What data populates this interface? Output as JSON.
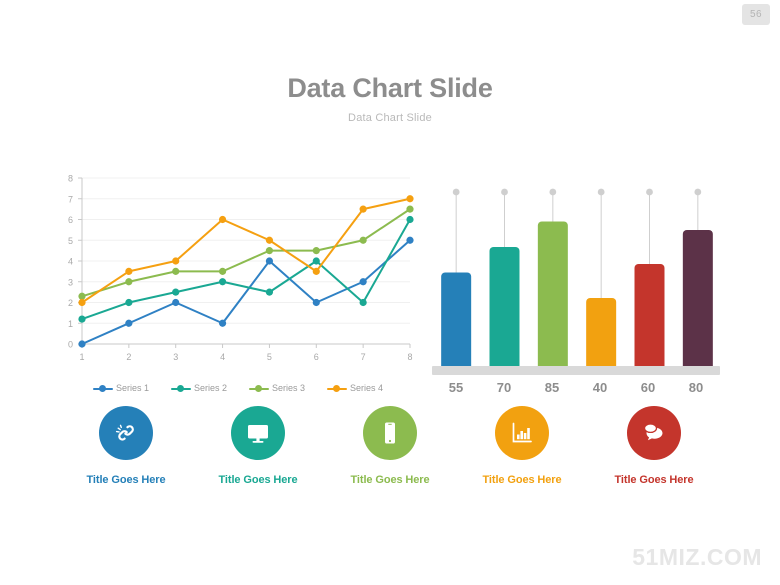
{
  "page_badge": "56",
  "header": {
    "title": "Data Chart Slide",
    "subtitle": "Data Chart Slide"
  },
  "watermark": "51MIZ.COM",
  "line_legend": [
    {
      "label": "Series 1",
      "color": "#2f81c4"
    },
    {
      "label": "Series 2",
      "color": "#1aa893"
    },
    {
      "label": "Series 3",
      "color": "#8cbb4f"
    },
    {
      "label": "Series 4",
      "color": "#f5a011"
    }
  ],
  "icons": [
    {
      "name": "broken-link-icon",
      "title": "Title Goes Here",
      "color": "#2580b8"
    },
    {
      "name": "desktop-monitor-icon",
      "title": "Title Goes Here",
      "color": "#1aa893"
    },
    {
      "name": "smartphone-icon",
      "title": "Title Goes Here",
      "color": "#8cbb4f"
    },
    {
      "name": "bar-chart-icon",
      "title": "Title Goes Here",
      "color": "#f2a110"
    },
    {
      "name": "speech-bubbles-icon",
      "title": "Title Goes Here",
      "color": "#c4352c"
    }
  ],
  "chart_data": [
    {
      "type": "line",
      "title": "",
      "xlabel": "",
      "ylabel": "",
      "x": [
        1,
        2,
        3,
        4,
        5,
        6,
        7,
        8
      ],
      "categories": [
        "1",
        "2",
        "3",
        "4",
        "5",
        "6",
        "7",
        "8"
      ],
      "xlim": [
        1,
        8
      ],
      "ylim": [
        0,
        8
      ],
      "yticks": [
        0,
        1,
        2,
        3,
        4,
        5,
        6,
        7,
        8
      ],
      "grid": true,
      "legend_position": "bottom",
      "series": [
        {
          "name": "Series 1",
          "color": "#2f81c4",
          "values": [
            0,
            1,
            2,
            1,
            4,
            2,
            3,
            5
          ]
        },
        {
          "name": "Series 2",
          "color": "#1aa893",
          "values": [
            1.2,
            2,
            2.5,
            3,
            2.5,
            4,
            2,
            6
          ]
        },
        {
          "name": "Series 3",
          "color": "#8cbb4f",
          "values": [
            2.3,
            3,
            3.5,
            3.5,
            4.5,
            4.5,
            5,
            6.5
          ]
        },
        {
          "name": "Series 4",
          "color": "#f5a011",
          "values": [
            2,
            3.5,
            4,
            6,
            5,
            3.5,
            6.5,
            7
          ]
        }
      ]
    },
    {
      "type": "bar",
      "title": "",
      "xlabel": "",
      "ylabel": "",
      "categories": [
        "55",
        "70",
        "85",
        "40",
        "60",
        "80"
      ],
      "values": [
        55,
        70,
        85,
        40,
        60,
        80
      ],
      "ylim": [
        0,
        100
      ],
      "grid": false,
      "colors": [
        "#2580b8",
        "#1aa893",
        "#8cbb4f",
        "#f2a110",
        "#c4352c",
        "#5c3248"
      ],
      "bar_labels": [
        "55",
        "70",
        "85",
        "40",
        "60",
        "80"
      ],
      "stem_color": "#cfcfcf",
      "baseline_color": "#d9d9d9"
    }
  ]
}
